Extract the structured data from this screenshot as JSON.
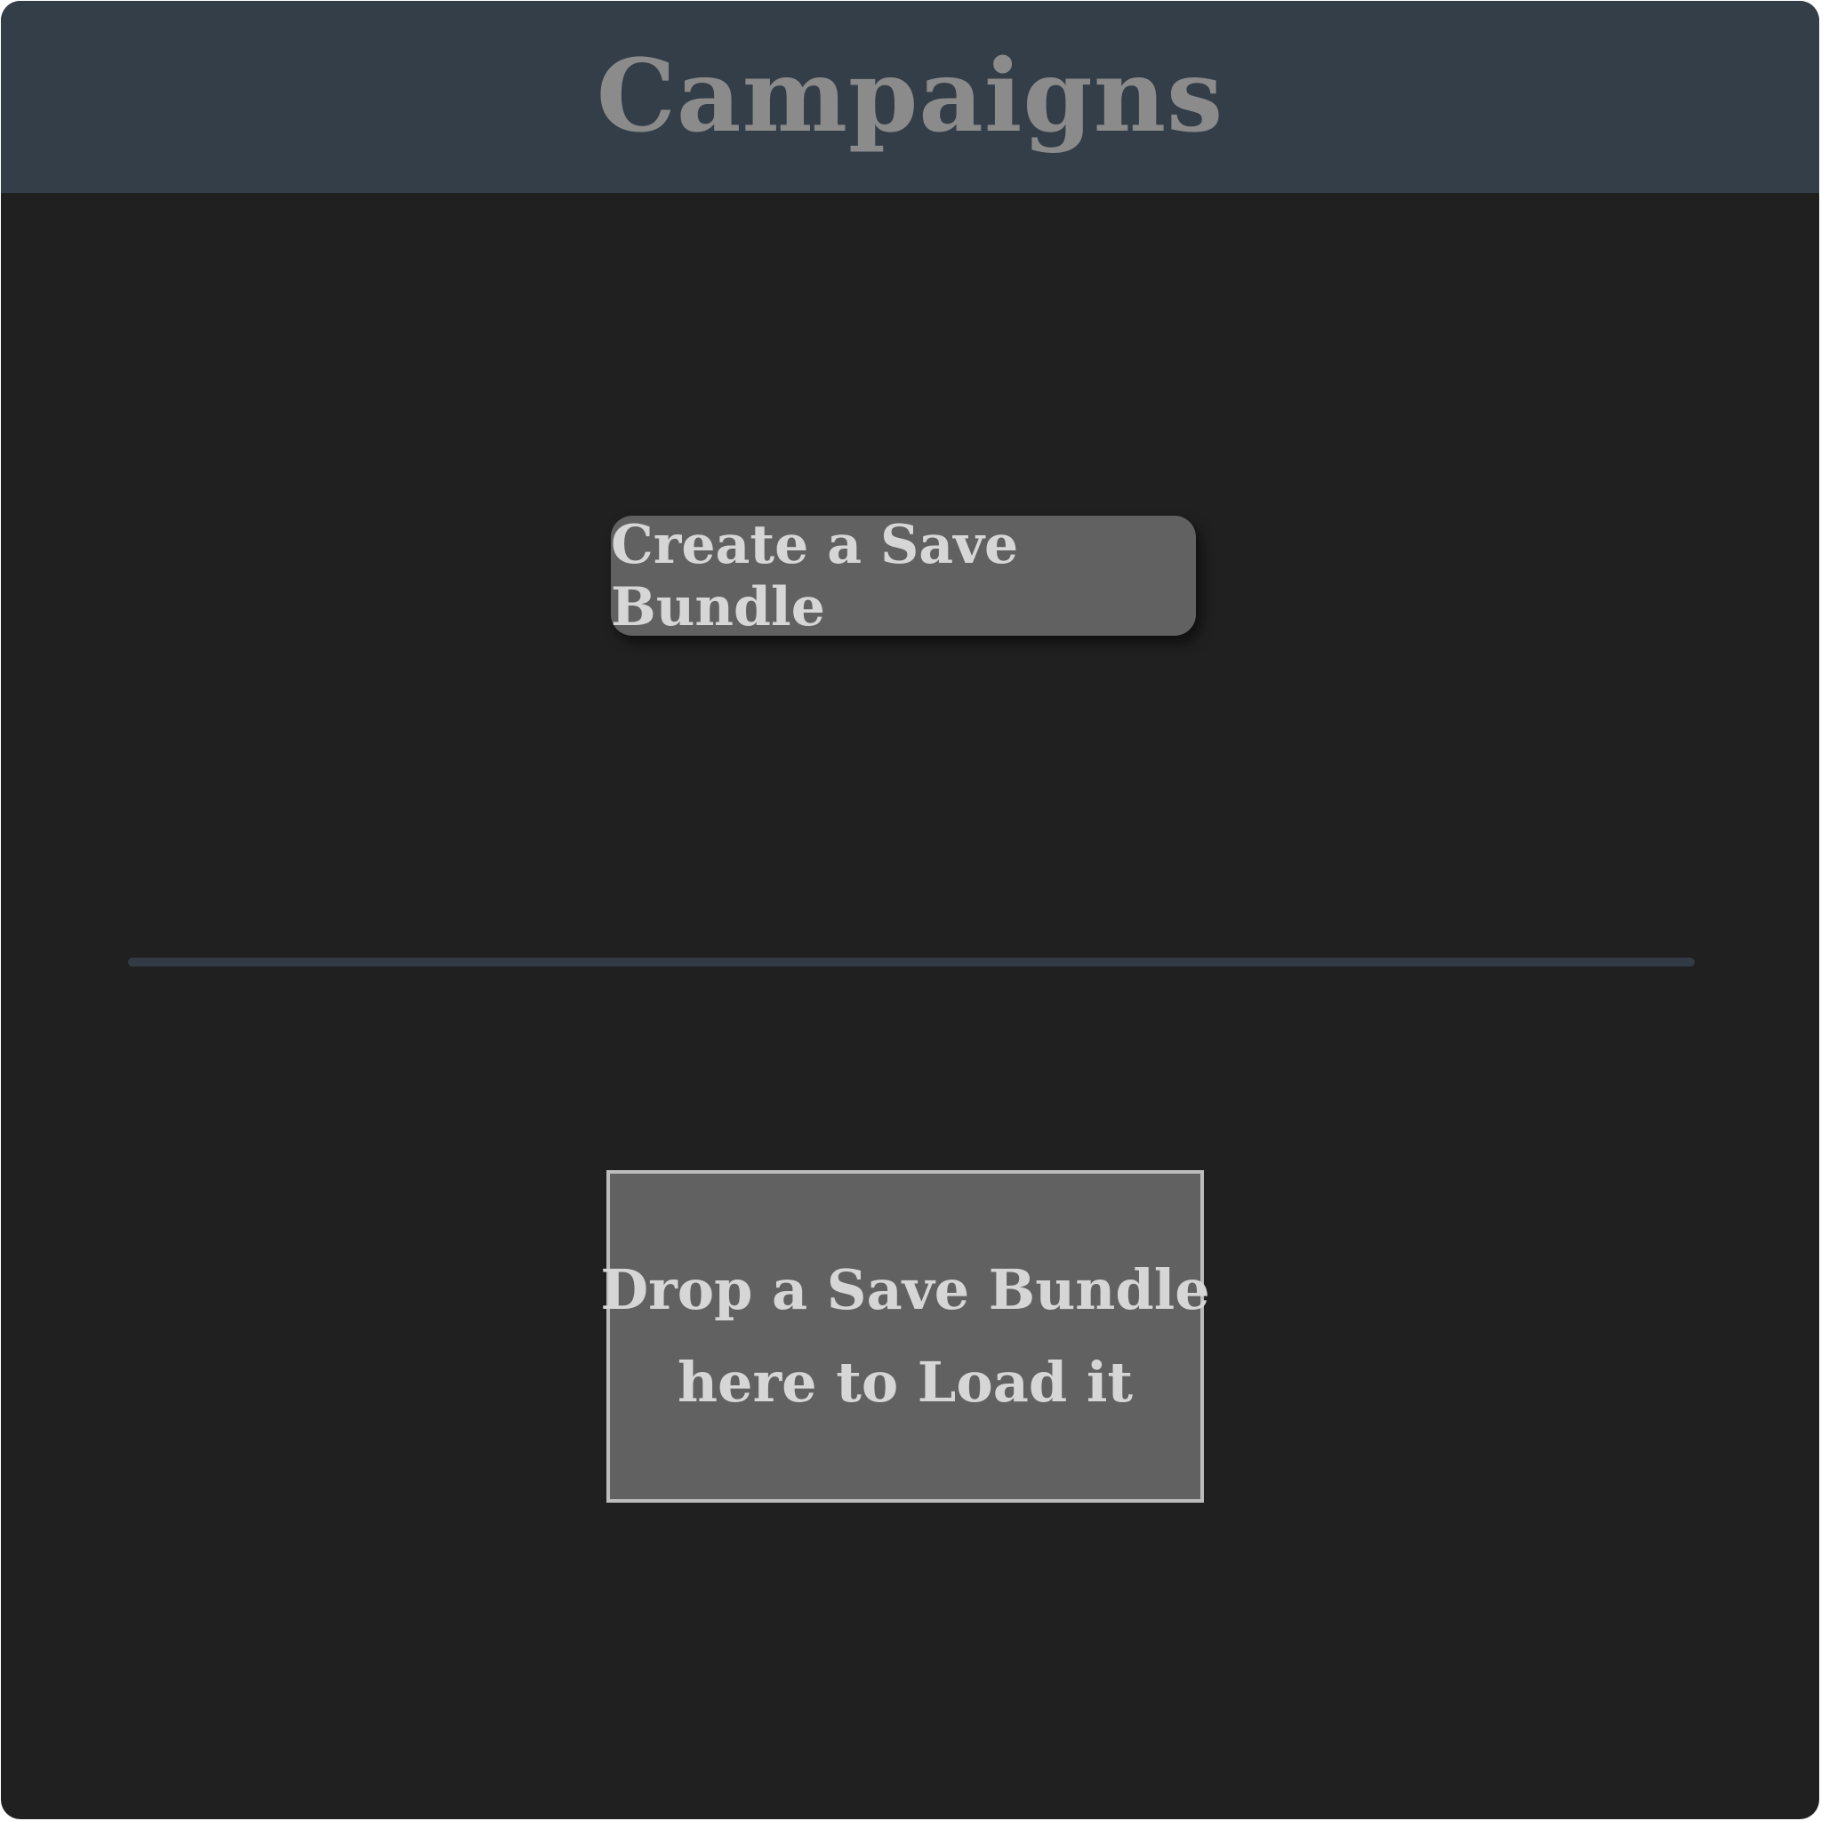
{
  "header": {
    "title": "Campaigns"
  },
  "create": {
    "label": "Create a Save Bundle"
  },
  "drop_zone": {
    "line1": "Drop a Save Bundle",
    "line2": "here to Load it"
  },
  "colors": {
    "panel_background": "#202020",
    "header_background": "#343e48",
    "title_text": "#8b8b8b",
    "button_background": "#616161",
    "button_text": "#d6d6d6",
    "divider": "#323b45",
    "drop_zone_border": "#bcbcbc"
  }
}
